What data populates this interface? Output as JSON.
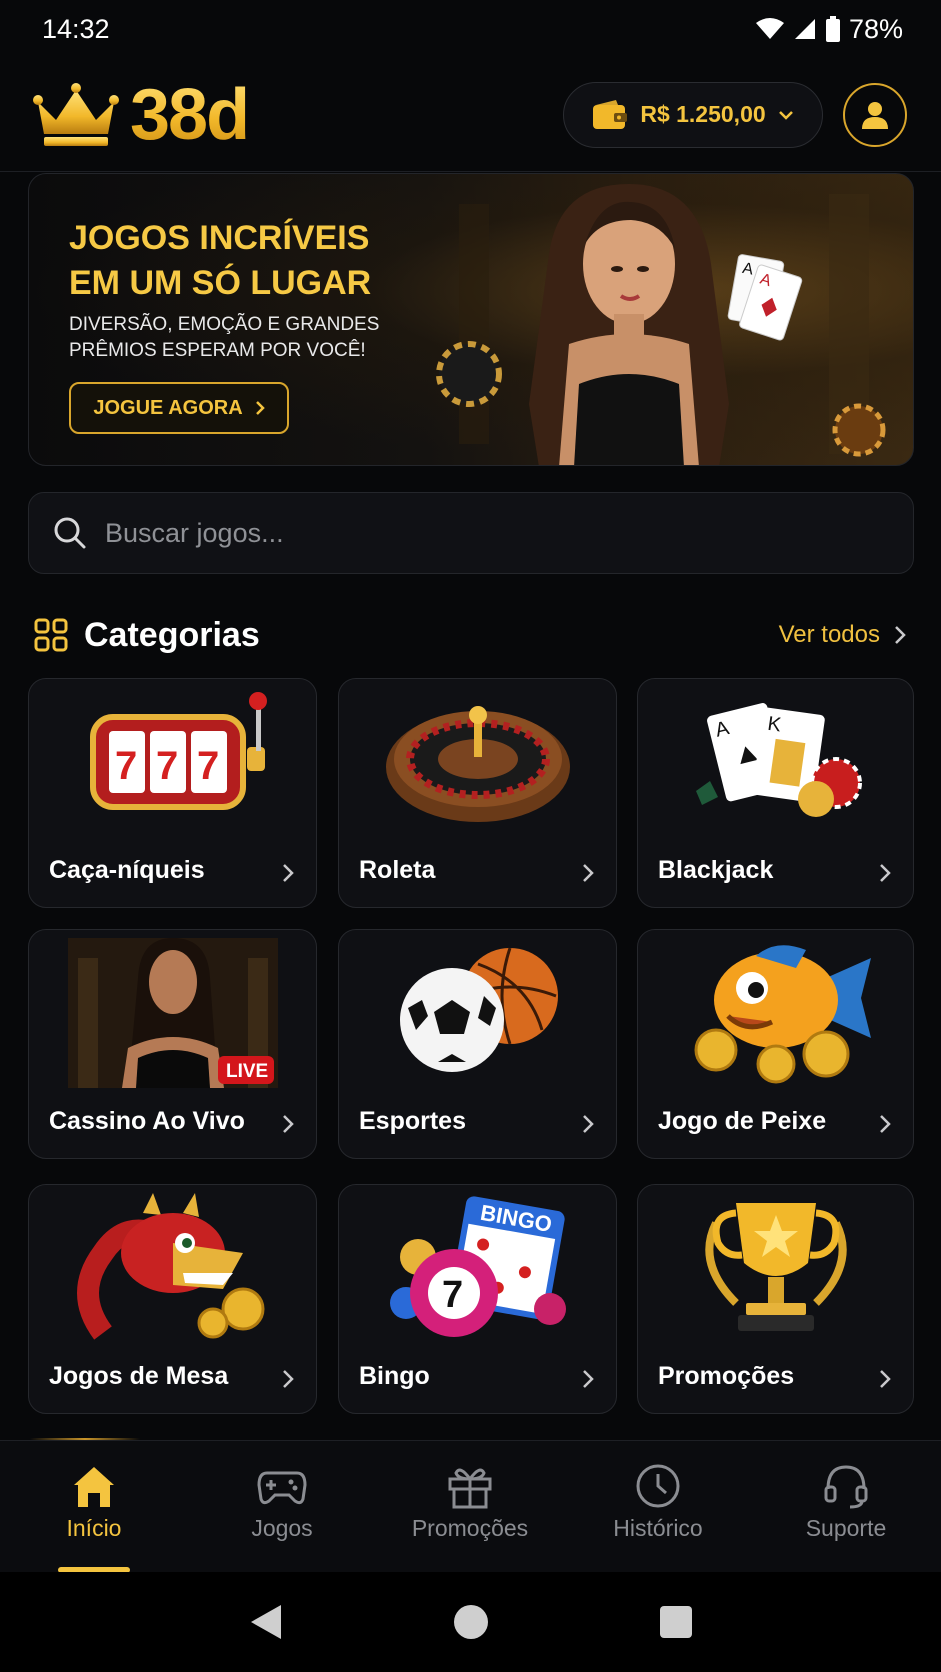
{
  "status_bar": {
    "time": "14:32",
    "battery": "78%"
  },
  "header": {
    "logo_text": "38d",
    "balance": "R$ 1.250,00",
    "accent_color": "#f4c43f"
  },
  "banner": {
    "title": "JOGOS INCRÍVEIS EM UM SÓ LUGAR",
    "subtitle": "DIVERSÃO, EMOÇÃO E GRANDES PRÊMIOS ESPERAM POR VOCÊ!",
    "cta": "JOGUE AGORA"
  },
  "search": {
    "placeholder": "Buscar jogos..."
  },
  "categories": {
    "title": "Categorias",
    "see_all": "Ver todos",
    "items": [
      {
        "label": "Caça-níqueis",
        "icon": "slot-machine-icon"
      },
      {
        "label": "Roleta",
        "icon": "roulette-icon"
      },
      {
        "label": "Blackjack",
        "icon": "playing-cards-icon"
      },
      {
        "label": "Cassino Ao Vivo",
        "icon": "live-dealer-icon",
        "badge": "LIVE"
      },
      {
        "label": "Esportes",
        "icon": "sports-balls-icon"
      },
      {
        "label": "Jogo de Peixe",
        "icon": "fish-icon"
      },
      {
        "label": "Jogos de Mesa",
        "icon": "dragon-icon"
      },
      {
        "label": "Bingo",
        "icon": "bingo-icon",
        "card_text": "BINGO",
        "ball_number": "7"
      },
      {
        "label": "Promoções",
        "icon": "trophy-icon"
      }
    ]
  },
  "bottom_nav": [
    {
      "label": "Início",
      "icon": "home-icon",
      "active": true
    },
    {
      "label": "Jogos",
      "icon": "gamepad-icon",
      "active": false
    },
    {
      "label": "Promoções",
      "icon": "gift-icon",
      "active": false
    },
    {
      "label": "Histórico",
      "icon": "clock-icon",
      "active": false
    },
    {
      "label": "Suporte",
      "icon": "headset-icon",
      "active": false
    }
  ]
}
